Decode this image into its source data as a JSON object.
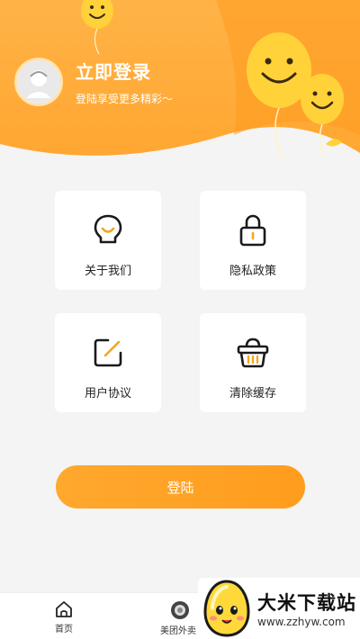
{
  "header": {
    "title": "立即登录",
    "subtitle": "登陆享受更多精彩～"
  },
  "menu": [
    {
      "label": "关于我们",
      "icon": "bulb-icon"
    },
    {
      "label": "隐私政策",
      "icon": "lock-icon"
    },
    {
      "label": "用户协议",
      "icon": "edit-icon"
    },
    {
      "label": "清除缓存",
      "icon": "basket-icon"
    }
  ],
  "login_button": {
    "label": "登陆"
  },
  "tabbar": {
    "home": {
      "label": "首页",
      "icon": "home-icon"
    },
    "meituan": {
      "label": "美团外卖",
      "icon": "mascot-icon"
    }
  },
  "watermark": {
    "title": "大米下载站",
    "url": "www.zzhyw.com"
  },
  "colors": {
    "accent": "#ffa630",
    "icon_accent": "#f5a623",
    "background": "#f4f4f4"
  }
}
